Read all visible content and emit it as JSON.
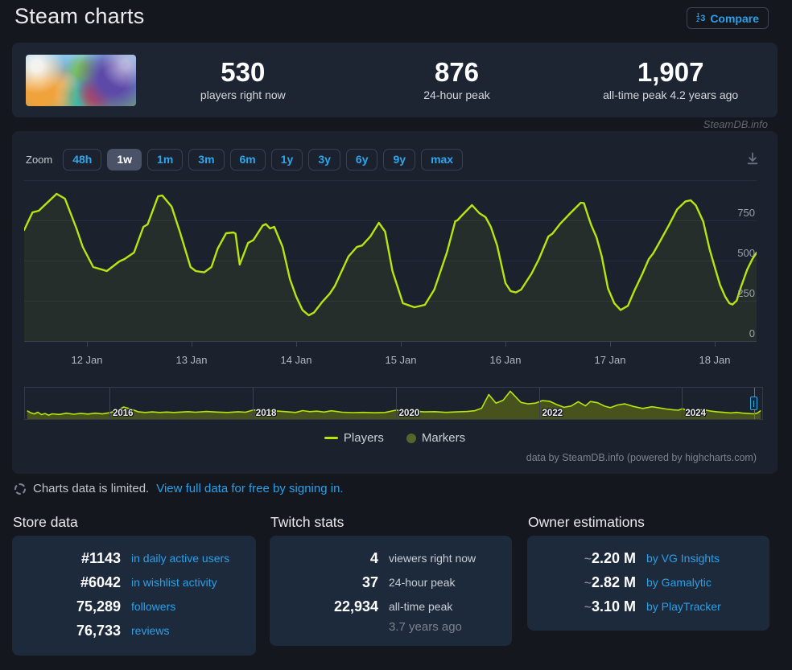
{
  "header": {
    "title": "Steam charts",
    "compare_label": "Compare",
    "compare_icon": {
      "d1": "1",
      "d2": "2",
      "d3": "3"
    }
  },
  "summary": {
    "stats": [
      {
        "value": "530",
        "label": "players right now"
      },
      {
        "value": "876",
        "label": "24-hour peak"
      },
      {
        "value": "1,907",
        "label": "all-time peak 4.2 years ago"
      }
    ]
  },
  "watermark": "SteamDB.info",
  "chart": {
    "zoom_label": "Zoom",
    "zoom_buttons": [
      {
        "label": "48h",
        "selected": false
      },
      {
        "label": "1w",
        "selected": true
      },
      {
        "label": "1m",
        "selected": false
      },
      {
        "label": "3m",
        "selected": false
      },
      {
        "label": "6m",
        "selected": false
      },
      {
        "label": "1y",
        "selected": false
      },
      {
        "label": "3y",
        "selected": false
      },
      {
        "label": "6y",
        "selected": false
      },
      {
        "label": "9y",
        "selected": false
      },
      {
        "label": "max",
        "selected": false
      }
    ],
    "credits": "data by SteamDB.info (powered by highcharts.com)"
  },
  "chart_data": {
    "type": "line",
    "x_unit": "days since 12 Jan 00:00",
    "xaxis": {
      "tick_labels": [
        "12 Jan",
        "13 Jan",
        "14 Jan",
        "15 Jan",
        "16 Jan",
        "17 Jan",
        "18 Jan"
      ],
      "visible_range": [
        -0.6,
        6.4
      ]
    },
    "yaxis": {
      "ticks": [
        750,
        500,
        250,
        0
      ],
      "range": [
        0,
        1000
      ],
      "grid": true,
      "labels_side": "right"
    },
    "legend": {
      "position": "bottom-center",
      "entries": [
        {
          "label": "Players",
          "swatch": "line",
          "color": "#b6e60e"
        },
        {
          "label": "Markers",
          "swatch": "circle",
          "color": "#57642c"
        }
      ]
    },
    "series": [
      {
        "name": "Players",
        "color": "#b6e60e",
        "points": [
          [
            -0.6,
            690
          ],
          [
            -0.52,
            800
          ],
          [
            -0.46,
            810
          ],
          [
            -0.42,
            835
          ],
          [
            -0.29,
            915
          ],
          [
            -0.21,
            885
          ],
          [
            -0.1,
            700
          ],
          [
            -0.04,
            585
          ],
          [
            0.06,
            460
          ],
          [
            0.14,
            445
          ],
          [
            0.19,
            435
          ],
          [
            0.31,
            495
          ],
          [
            0.36,
            510
          ],
          [
            0.45,
            550
          ],
          [
            0.54,
            710
          ],
          [
            0.58,
            725
          ],
          [
            0.68,
            900
          ],
          [
            0.72,
            905
          ],
          [
            0.81,
            835
          ],
          [
            0.89,
            675
          ],
          [
            0.99,
            460
          ],
          [
            1.04,
            435
          ],
          [
            1.12,
            427
          ],
          [
            1.19,
            460
          ],
          [
            1.25,
            575
          ],
          [
            1.33,
            670
          ],
          [
            1.4,
            675
          ],
          [
            1.42,
            668
          ],
          [
            1.46,
            475
          ],
          [
            1.54,
            610
          ],
          [
            1.59,
            627
          ],
          [
            1.68,
            718
          ],
          [
            1.71,
            727
          ],
          [
            1.75,
            700
          ],
          [
            1.79,
            710
          ],
          [
            1.87,
            585
          ],
          [
            1.94,
            385
          ],
          [
            2.0,
            276
          ],
          [
            2.06,
            193
          ],
          [
            2.12,
            160
          ],
          [
            2.17,
            177
          ],
          [
            2.25,
            244
          ],
          [
            2.32,
            294
          ],
          [
            2.37,
            343
          ],
          [
            2.5,
            526
          ],
          [
            2.58,
            585
          ],
          [
            2.63,
            594
          ],
          [
            2.71,
            651
          ],
          [
            2.79,
            735
          ],
          [
            2.85,
            680
          ],
          [
            2.92,
            435
          ],
          [
            3.02,
            235
          ],
          [
            3.13,
            210
          ],
          [
            3.23,
            225
          ],
          [
            3.32,
            320
          ],
          [
            3.44,
            550
          ],
          [
            3.52,
            745
          ],
          [
            3.54,
            750
          ],
          [
            3.59,
            785
          ],
          [
            3.68,
            845
          ],
          [
            3.75,
            795
          ],
          [
            3.81,
            770
          ],
          [
            3.86,
            710
          ],
          [
            3.92,
            595
          ],
          [
            4.0,
            360
          ],
          [
            4.05,
            310
          ],
          [
            4.1,
            302
          ],
          [
            4.15,
            320
          ],
          [
            4.25,
            420
          ],
          [
            4.32,
            510
          ],
          [
            4.41,
            650
          ],
          [
            4.45,
            668
          ],
          [
            4.52,
            727
          ],
          [
            4.62,
            795
          ],
          [
            4.72,
            860
          ],
          [
            4.75,
            857
          ],
          [
            4.79,
            777
          ],
          [
            4.82,
            720
          ],
          [
            4.87,
            645
          ],
          [
            4.92,
            527
          ],
          [
            4.98,
            327
          ],
          [
            5.04,
            235
          ],
          [
            5.1,
            193
          ],
          [
            5.17,
            219
          ],
          [
            5.23,
            310
          ],
          [
            5.31,
            420
          ],
          [
            5.37,
            510
          ],
          [
            5.41,
            543
          ],
          [
            5.46,
            600
          ],
          [
            5.56,
            718
          ],
          [
            5.64,
            818
          ],
          [
            5.72,
            868
          ],
          [
            5.77,
            875
          ],
          [
            5.82,
            843
          ],
          [
            5.89,
            743
          ],
          [
            5.95,
            573
          ],
          [
            6.0,
            460
          ],
          [
            6.05,
            350
          ],
          [
            6.1,
            276
          ],
          [
            6.14,
            235
          ],
          [
            6.17,
            227
          ],
          [
            6.21,
            252
          ],
          [
            6.25,
            335
          ],
          [
            6.31,
            444
          ],
          [
            6.36,
            510
          ],
          [
            6.4,
            550
          ]
        ]
      },
      {
        "name": "Markers",
        "color": "#57642c",
        "points": []
      }
    ],
    "navigator": {
      "range": [
        2014.82,
        2025.12
      ],
      "max_value": 1900,
      "year_ticks": [
        2016,
        2018,
        2020,
        2022,
        2024
      ],
      "points": [
        [
          2014.85,
          520
        ],
        [
          2014.9,
          380
        ],
        [
          2014.95,
          300
        ],
        [
          2015.0,
          420
        ],
        [
          2015.05,
          250
        ],
        [
          2015.1,
          330
        ],
        [
          2015.15,
          210
        ],
        [
          2015.2,
          310
        ],
        [
          2015.3,
          260
        ],
        [
          2015.4,
          350
        ],
        [
          2015.5,
          280
        ],
        [
          2015.6,
          340
        ],
        [
          2015.7,
          290
        ],
        [
          2015.8,
          350
        ],
        [
          2015.9,
          300
        ],
        [
          2016.0,
          380
        ],
        [
          2016.1,
          520
        ],
        [
          2016.2,
          780
        ],
        [
          2016.3,
          640
        ],
        [
          2016.4,
          450
        ],
        [
          2016.5,
          400
        ],
        [
          2016.6,
          440
        ],
        [
          2016.7,
          400
        ],
        [
          2016.8,
          430
        ],
        [
          2016.9,
          400
        ],
        [
          2017.0,
          430
        ],
        [
          2017.1,
          460
        ],
        [
          2017.2,
          420
        ],
        [
          2017.35,
          470
        ],
        [
          2017.5,
          430
        ],
        [
          2017.65,
          400
        ],
        [
          2017.8,
          450
        ],
        [
          2017.9,
          420
        ],
        [
          2018.0,
          560
        ],
        [
          2018.1,
          600
        ],
        [
          2018.2,
          540
        ],
        [
          2018.35,
          500
        ],
        [
          2018.5,
          440
        ],
        [
          2018.6,
          400
        ],
        [
          2018.7,
          530
        ],
        [
          2018.8,
          460
        ],
        [
          2018.9,
          490
        ],
        [
          2019.0,
          430
        ],
        [
          2019.1,
          520
        ],
        [
          2019.25,
          420
        ],
        [
          2019.4,
          390
        ],
        [
          2019.55,
          410
        ],
        [
          2019.7,
          380
        ],
        [
          2019.85,
          400
        ],
        [
          2020.0,
          560
        ],
        [
          2020.1,
          540
        ],
        [
          2020.25,
          500
        ],
        [
          2020.4,
          440
        ],
        [
          2020.55,
          460
        ],
        [
          2020.7,
          410
        ],
        [
          2020.85,
          440
        ],
        [
          2021.0,
          470
        ],
        [
          2021.1,
          520
        ],
        [
          2021.2,
          700
        ],
        [
          2021.3,
          1650
        ],
        [
          2021.4,
          1050
        ],
        [
          2021.5,
          1250
        ],
        [
          2021.6,
          1880
        ],
        [
          2021.7,
          1350
        ],
        [
          2021.75,
          1100
        ],
        [
          2021.85,
          1000
        ],
        [
          2021.95,
          1050
        ],
        [
          2022.05,
          1230
        ],
        [
          2022.15,
          1180
        ],
        [
          2022.25,
          950
        ],
        [
          2022.35,
          760
        ],
        [
          2022.45,
          850
        ],
        [
          2022.55,
          1150
        ],
        [
          2022.65,
          860
        ],
        [
          2022.72,
          1160
        ],
        [
          2022.82,
          1080
        ],
        [
          2022.92,
          840
        ],
        [
          2023.0,
          740
        ],
        [
          2023.1,
          920
        ],
        [
          2023.2,
          1000
        ],
        [
          2023.32,
          820
        ],
        [
          2023.45,
          680
        ],
        [
          2023.58,
          800
        ],
        [
          2023.68,
          720
        ],
        [
          2023.78,
          640
        ],
        [
          2023.88,
          580
        ],
        [
          2023.95,
          560
        ],
        [
          2024.0,
          660
        ],
        [
          2024.1,
          520
        ],
        [
          2024.2,
          540
        ],
        [
          2024.3,
          600
        ],
        [
          2024.4,
          500
        ],
        [
          2024.5,
          440
        ],
        [
          2024.6,
          400
        ],
        [
          2024.68,
          370
        ],
        [
          2024.76,
          410
        ],
        [
          2024.84,
          360
        ],
        [
          2024.92,
          330
        ],
        [
          2025.0,
          310
        ],
        [
          2025.05,
          360
        ],
        [
          2025.1,
          530
        ]
      ]
    }
  },
  "notice": {
    "text": "Charts data is limited.",
    "link": "View full data for free by signing in."
  },
  "sections": {
    "store": {
      "title": "Store data",
      "rows": [
        {
          "value": "#1143",
          "label": "in daily active users",
          "link": true
        },
        {
          "value": "#6042",
          "label": "in wishlist activity",
          "link": true
        },
        {
          "value": "75,289",
          "label": "followers",
          "link": true
        },
        {
          "value": "76,733",
          "label": "reviews",
          "link": true
        }
      ]
    },
    "twitch": {
      "title": "Twitch stats",
      "rows": [
        {
          "value": "4",
          "label": "viewers right now",
          "link": false
        },
        {
          "value": "37",
          "label": "24-hour peak",
          "link": false
        },
        {
          "value": "22,934",
          "label": "all-time peak",
          "link": false
        },
        {
          "value": "",
          "label": "3.7 years ago",
          "link": false,
          "sub": true
        }
      ]
    },
    "owners": {
      "title": "Owner estimations",
      "rows": [
        {
          "prefix": "~",
          "value": "2.20 M",
          "label": "by VG Insights",
          "link": true
        },
        {
          "prefix": "~",
          "value": "2.82 M",
          "label": "by Gamalytic",
          "link": true
        },
        {
          "prefix": "~",
          "value": "3.10 M",
          "label": "by PlayTracker",
          "link": true
        }
      ]
    }
  }
}
